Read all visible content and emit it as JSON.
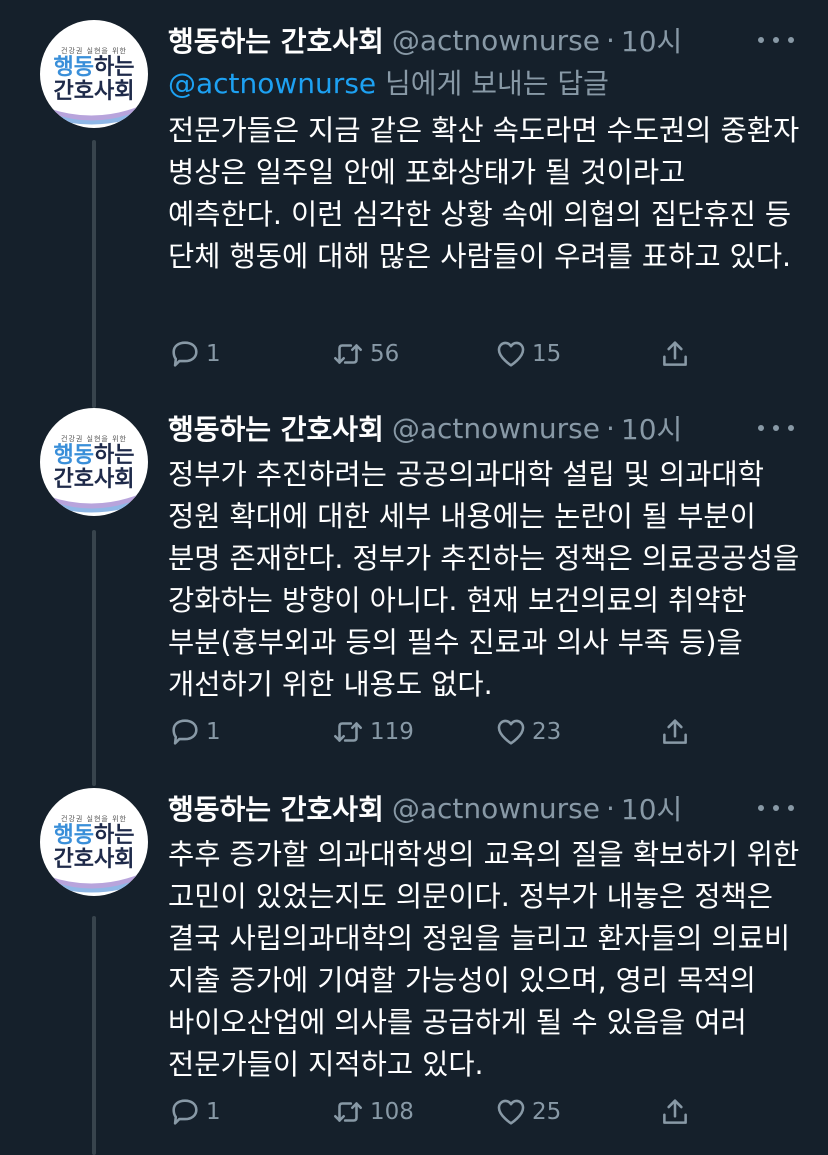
{
  "account": {
    "name": "행동하는 간호사회",
    "handle": "@actnownurse",
    "avatar_text": {
      "slogan": "건강권 실현을 위한",
      "line1_a": "행동",
      "line1_b": "하는",
      "line2": "간호사회"
    }
  },
  "tweets": [
    {
      "time": "10시",
      "reply_to": {
        "mention": "@actnownurse",
        "suffix": " 님에게 보내는 답글"
      },
      "text": "전문가들은 지금 같은 확산 속도라면 수도권의 중환자 병상은 일주일 안에 포화상태가 될 것이라고 예측한다. 이런 심각한 상황 속에 의협의 집단휴진 등 단체 행동에 대해 많은 사람들이 우려를 표하고 있다.",
      "replies": "1",
      "retweets": "56",
      "likes": "15"
    },
    {
      "time": "10시",
      "text": "정부가 추진하려는 공공의과대학 설립 및 의과대학 정원 확대에 대한 세부 내용에는 논란이 될 부분이 분명 존재한다. 정부가 추진하는 정책은 의료공공성을 강화하는 방향이 아니다. 현재 보건의료의 취약한 부분(흉부외과 등의 필수 진료과 의사 부족 등)을 개선하기 위한 내용도 없다.",
      "replies": "1",
      "retweets": "119",
      "likes": "23"
    },
    {
      "time": "10시",
      "text": "추후 증가할 의과대학생의 교육의 질을 확보하기 위한 고민이 있었는지도 의문이다. 정부가 내놓은 정책은 결국 사립의과대학의 정원을 늘리고 환자들의 의료비 지출 증가에 기여할 가능성이 있으며, 영리 목적의 바이오산업에 의사를 공급하게 될 수 있음을 여러 전문가들이 지적하고 있다.",
      "replies": "1",
      "retweets": "108",
      "likes": "25"
    }
  ],
  "separator": "·",
  "colors": {
    "background": "#15202b",
    "secondary_text": "#8899a6",
    "link": "#1da1f2",
    "thread_line": "#38444d"
  },
  "icons": {
    "reply": "speech-bubble-icon",
    "retweet": "retweet-arrows-icon",
    "like": "heart-icon",
    "share": "share-upload-icon",
    "more": "ellipsis-icon"
  }
}
